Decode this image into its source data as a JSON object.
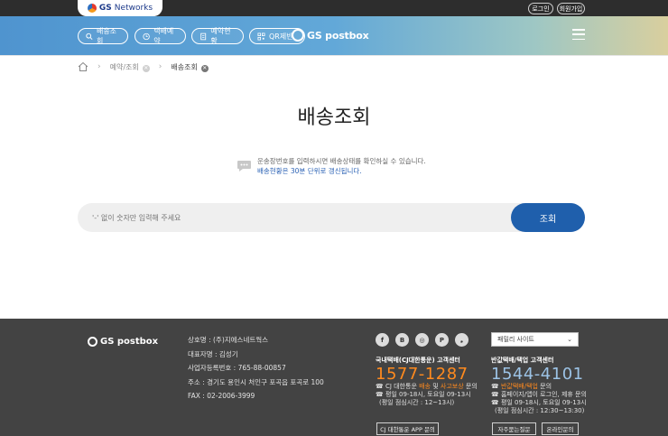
{
  "topbar": {
    "network_name": "Networks",
    "network_prefix": "GS",
    "login": "로그인",
    "signup": "회원가입"
  },
  "nav": {
    "items": [
      {
        "label": "배송조회",
        "icon": "search-icon"
      },
      {
        "label": "택배예약",
        "icon": "clock-icon"
      },
      {
        "label": "예약현황",
        "icon": "document-icon"
      },
      {
        "label": "QR제반",
        "icon": "qr-icon"
      }
    ],
    "brand": "GS postbox",
    "menu_icon": "hamburger-icon"
  },
  "breadcrumb": {
    "home_icon": "home-icon",
    "level1": "예약/조회",
    "level2": "배송조회"
  },
  "main": {
    "title": "배송조회",
    "notice_line1": "운송장번호를 입력하시면 배송상태를 확인하실 수 있습니다.",
    "notice_line2": "배송현황은 30분 단위로 갱신됩니다.",
    "search_placeholder": "'-' 없이 숫자만 입력해 주세요",
    "search_button": "조회"
  },
  "footer": {
    "brand": "GS postbox",
    "company": "상호명 : (주)지에스네트웍스",
    "ceo": "대표자명 : 김성기",
    "biz_no": "사업자등록번호 : 765-88-00857",
    "address": "주소 : 경기도 용인시 처인구 포곡읍 포곡로 100",
    "fax": "FAX : 02-2006-3999",
    "social": [
      "f",
      "B",
      "◎",
      "P",
      "❟"
    ],
    "cs1": {
      "head": "국내택배(CJ대한통운) 고객센터",
      "phone": "1577-1287",
      "line1_pre": "☎ CJ 대한통운 ",
      "line1_a": "배송",
      "line1_mid": " 및 ",
      "line1_b": "사고보상",
      "line1_post": " 문의",
      "line2": "☎ 평일 09-18시, 토요일 09-13시",
      "line3": "(평일 점심시간 : 12~13시)",
      "button": "CJ 대한통운 APP 문의"
    },
    "cs2": {
      "head": "반값택배/택업 고객센터",
      "phone": "1544-4101",
      "line1_pre": "☎ ",
      "line1_a": "반값택배/택업",
      "line1_post": " 문의",
      "line2": "☎ 홈페이지/앱이 로그인, 제휴 문의",
      "line3": "☎ 평일 09-18시, 토요일 09-13시",
      "line4": "(평일 점심시간 : 12:30~13:30)",
      "button1": "자주묻는질문",
      "button2": "온라인문의"
    },
    "family_site": "패밀리 사이트"
  },
  "colors": {
    "primary_blue": "#1f5fac",
    "footer_bg": "#434343",
    "accent_orange": "#ff8a1e"
  }
}
